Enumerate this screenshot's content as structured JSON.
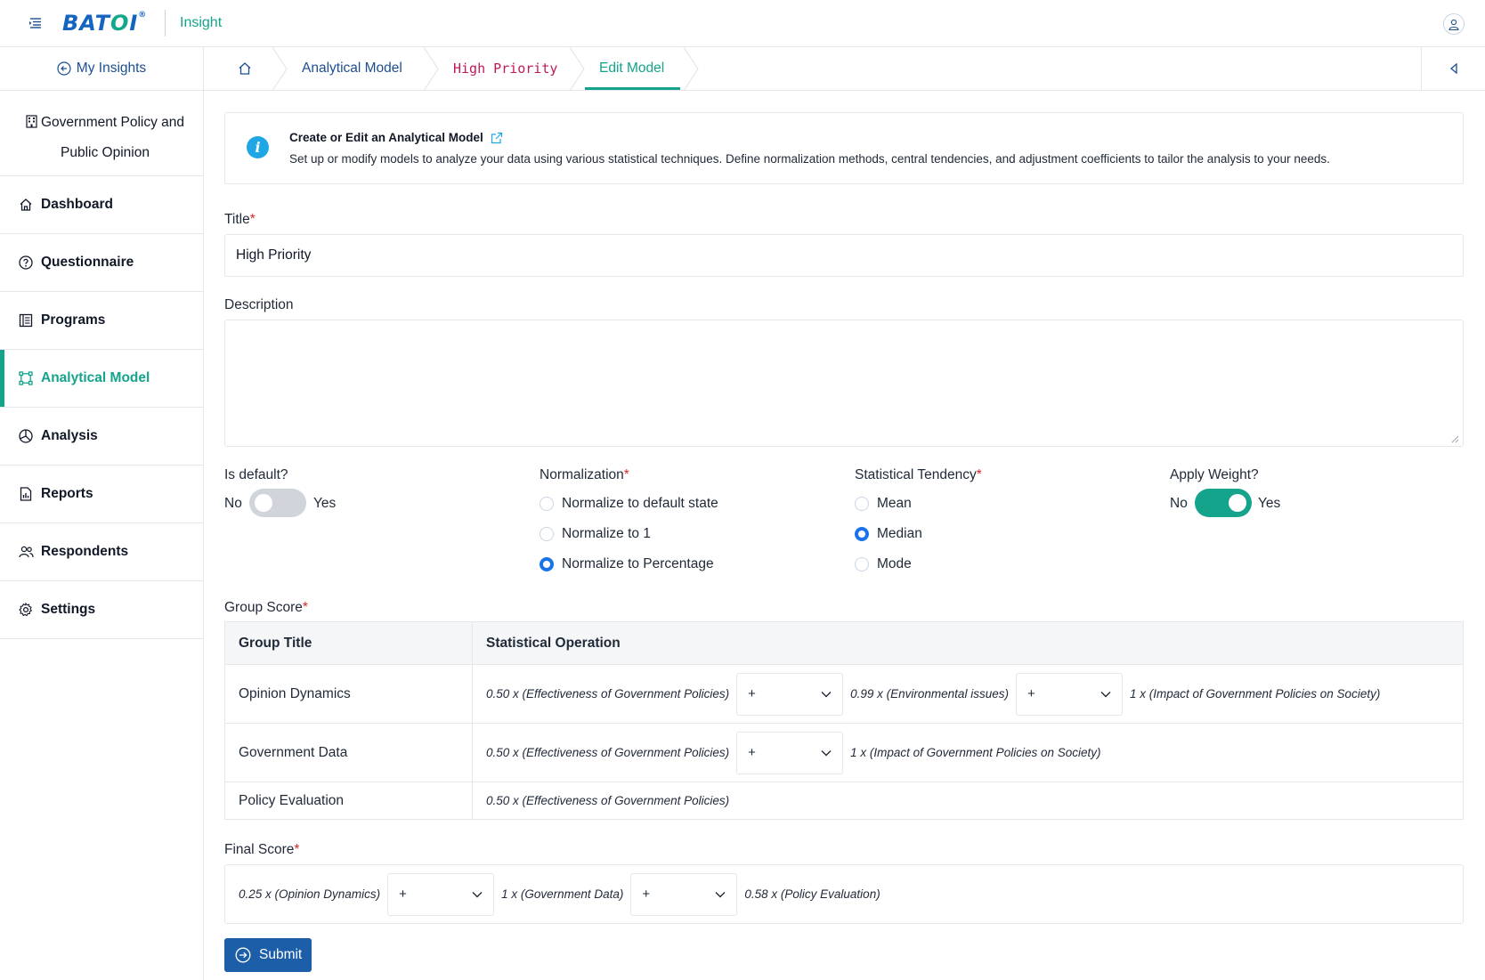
{
  "app": {
    "logo_text": "BATOI",
    "name": "Insight"
  },
  "sidebar": {
    "back_label": "My Insights",
    "project_name": "Government Policy and Public Opinion",
    "items": [
      {
        "label": "Dashboard",
        "icon": "home-icon"
      },
      {
        "label": "Questionnaire",
        "icon": "question-circle-icon"
      },
      {
        "label": "Programs",
        "icon": "list-icon"
      },
      {
        "label": "Analytical Model",
        "icon": "model-icon",
        "active": true
      },
      {
        "label": "Analysis",
        "icon": "pie-chart-icon"
      },
      {
        "label": "Reports",
        "icon": "report-icon"
      },
      {
        "label": "Respondents",
        "icon": "users-icon"
      },
      {
        "label": "Settings",
        "icon": "gear-icon"
      }
    ]
  },
  "breadcrumb": {
    "items": [
      "Analytical Model",
      "High Priority",
      "Edit Model"
    ]
  },
  "info": {
    "title": "Create or Edit an Analytical Model",
    "text": "Set up or modify models to analyze your data using various statistical techniques. Define normalization methods, central tendencies, and adjustment coefficients to tailor the analysis to your needs."
  },
  "form": {
    "title_label": "Title",
    "title_value": "High Priority",
    "description_label": "Description",
    "description_value": "",
    "is_default": {
      "label": "Is default?",
      "no": "No",
      "yes": "Yes",
      "value": false
    },
    "normalization": {
      "label": "Normalization",
      "options": [
        "Normalize to default state",
        "Normalize to 1",
        "Normalize to Percentage"
      ],
      "selected": "Normalize to Percentage"
    },
    "statistical_tendency": {
      "label": "Statistical Tendency",
      "options": [
        "Mean",
        "Median",
        "Mode"
      ],
      "selected": "Median"
    },
    "apply_weight": {
      "label": "Apply Weight?",
      "no": "No",
      "yes": "Yes",
      "value": true
    }
  },
  "group_score": {
    "label": "Group Score",
    "headers": [
      "Group Title",
      "Statistical Operation"
    ],
    "rows": [
      {
        "title": "Opinion Dynamics",
        "terms": [
          "0.50 x (Effectiveness of Government Policies)",
          "0.99 x (Environmental issues)",
          "1 x (Impact of Government Policies on Society)"
        ],
        "operators": [
          "+",
          "+"
        ]
      },
      {
        "title": "Government Data",
        "terms": [
          "0.50 x (Effectiveness of Government Policies)",
          "1 x (Impact of Government Policies on Society)"
        ],
        "operators": [
          "+"
        ]
      },
      {
        "title": "Policy Evaluation",
        "terms": [
          "0.50 x (Effectiveness of Government Policies)"
        ],
        "operators": []
      }
    ]
  },
  "final_score": {
    "label": "Final Score",
    "terms": [
      "0.25 x (Opinion Dynamics)",
      "1 x (Government Data)",
      "0.58 x (Policy Evaluation)"
    ],
    "operators": [
      "+",
      "+"
    ]
  },
  "submit_label": "Submit",
  "colors": {
    "accent": "#14a38b",
    "primary": "#1d5ea8",
    "link": "#1d4f91",
    "required": "#dc2626",
    "radio": "#1a73e8"
  }
}
